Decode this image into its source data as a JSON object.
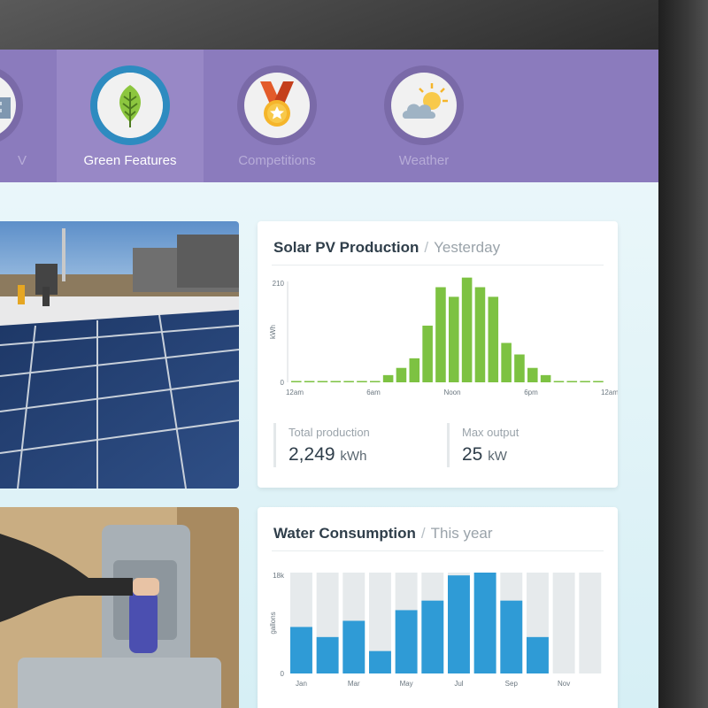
{
  "nav": {
    "items": [
      {
        "label": "V",
        "icon": "building-icon",
        "active": false
      },
      {
        "label": "Green Features",
        "icon": "leaf-icon",
        "active": true
      },
      {
        "label": "Competitions",
        "icon": "medal-icon",
        "active": false
      },
      {
        "label": "Weather",
        "icon": "partly-cloudy-icon",
        "active": false
      }
    ]
  },
  "solar_card": {
    "title": "Solar PV Production",
    "separator": "/",
    "period": "Yesterday",
    "stats": [
      {
        "label": "Total production",
        "value": "2,249",
        "unit": "kWh"
      },
      {
        "label": "Max output",
        "value": "25",
        "unit": "kW"
      }
    ]
  },
  "water_card": {
    "title": "Water Consumption",
    "separator": "/",
    "period": "This year"
  },
  "colors": {
    "nav_bg": "#8b7bbd",
    "solar_bar": "#7dc242",
    "water_bar": "#2f9bd6",
    "water_track": "#e6eaec"
  },
  "chart_data": [
    {
      "type": "bar",
      "ylabel": "kWh",
      "ylim": [
        0,
        210
      ],
      "y_ticks": [
        "0",
        "210"
      ],
      "x_tick_labels": [
        "12am",
        "6am",
        "Noon",
        "6pm",
        "12am"
      ],
      "hours": [
        0,
        1,
        2,
        3,
        4,
        5,
        6,
        7,
        8,
        9,
        10,
        11,
        12,
        13,
        14,
        15,
        16,
        17,
        18,
        19,
        20,
        21,
        22,
        23
      ],
      "values": [
        2,
        2,
        2,
        2,
        2,
        2,
        2,
        15,
        30,
        50,
        118,
        198,
        178,
        218,
        198,
        178,
        82,
        58,
        30,
        15,
        2,
        2,
        2,
        2
      ],
      "grid": false
    },
    {
      "type": "bar",
      "ylabel": "gallons",
      "ylim": [
        0,
        18000
      ],
      "y_ticks": [
        "0",
        "18k"
      ],
      "categories": [
        "Jan",
        "Feb",
        "Mar",
        "Apr",
        "May",
        "Jun",
        "Jul",
        "Aug",
        "Sep",
        "Oct",
        "Nov",
        "Dec"
      ],
      "x_tick_labels": [
        "Jan",
        "Mar",
        "May",
        "Jul",
        "Sep",
        "Nov"
      ],
      "values": [
        8300,
        6500,
        9400,
        4000,
        11300,
        13000,
        17500,
        18900,
        13000,
        6500,
        0,
        0
      ],
      "grid": false
    }
  ]
}
